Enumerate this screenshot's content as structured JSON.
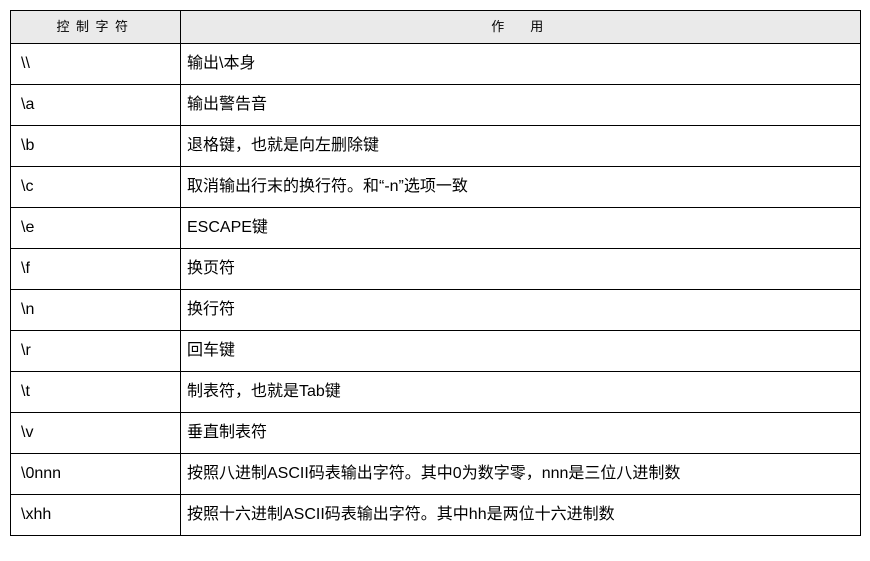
{
  "table": {
    "headers": {
      "col1": "控制字符",
      "col2": "作　用"
    },
    "rows": [
      {
        "char": "\\\\",
        "desc": "输出\\本身"
      },
      {
        "char": "\\a",
        "desc": "输出警告音"
      },
      {
        "char": "\\b",
        "desc": "退格键，也就是向左删除键"
      },
      {
        "char": "\\c",
        "desc": "取消输出行末的换行符。和“-n”选项一致"
      },
      {
        "char": "\\e",
        "desc": "ESCAPE键"
      },
      {
        "char": "\\f",
        "desc": "换页符"
      },
      {
        "char": "\\n",
        "desc": "换行符"
      },
      {
        "char": "\\r",
        "desc": "回车键"
      },
      {
        "char": "\\t",
        "desc": "制表符，也就是Tab键"
      },
      {
        "char": "\\v",
        "desc": "垂直制表符"
      },
      {
        "char": "\\0nnn",
        "desc": "按照八进制ASCII码表输出字符。其中0为数字零，nnn是三位八进制数"
      },
      {
        "char": "\\xhh",
        "desc": "按照十六进制ASCII码表输出字符。其中hh是两位十六进制数"
      }
    ]
  }
}
